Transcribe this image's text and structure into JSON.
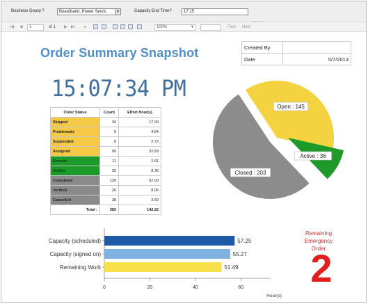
{
  "params": {
    "business_group_label": "Business Gourp ?",
    "business_group_value": "Boardband, Power Servic",
    "capacity_end_label": "Capacity End Time?",
    "capacity_end_value": "17:15"
  },
  "toolbar": {
    "page_current": "1",
    "page_of": "of 1",
    "zoom": "100%",
    "find_label": "Find",
    "next_label": "Next"
  },
  "report": {
    "title": "Order Summary Snapshot",
    "created_by_label": "Created By",
    "created_by_value": "",
    "date_label": "Date",
    "date_value": "5/7/2013",
    "clock": "15:07:34 PM",
    "emergency_label_1": "Remaining",
    "emergency_label_2": "Emergency Order",
    "emergency_value": "2"
  },
  "status_table": {
    "headers": [
      "Order Status",
      "Count",
      "Effort Hour(s)"
    ],
    "rows": [
      {
        "status": "Skipped",
        "count": "34",
        "hours": "17.00",
        "color": "#f5c945",
        "text_color": "#222222"
      },
      {
        "status": "Problematic",
        "count": "5",
        "hours": "4.94",
        "color": "#f5c945",
        "text_color": "#222222"
      },
      {
        "status": "Suspended",
        "count": "6",
        "hours": "2.72",
        "color": "#f5c945",
        "text_color": "#222222"
      },
      {
        "status": "Assigned",
        "count": "99",
        "hours": "32.83",
        "color": "#f5c945",
        "text_color": "#222222"
      },
      {
        "status": "Enroute",
        "count": "11",
        "hours": "2.61",
        "color": "#1d9b2a",
        "text_color": "#0b3d10"
      },
      {
        "status": "OnSite",
        "count": "25",
        "hours": "8.36",
        "color": "#1d9b2a",
        "text_color": "#0b3d10"
      },
      {
        "status": "Completed",
        "count": "139",
        "hours": "62.00",
        "color": "#8a8a8a",
        "text_color": "#222222"
      },
      {
        "status": "Verified",
        "count": "26",
        "hours": "8.06",
        "color": "#8a8a8a",
        "text_color": "#222222"
      },
      {
        "status": "Cancelled",
        "count": "38",
        "hours": "3.69",
        "color": "#8a8a8a",
        "text_color": "#222222"
      }
    ],
    "total_label": "Total :",
    "total_count": "383",
    "total_hours": "142.22"
  },
  "chart_data": [
    {
      "type": "pie",
      "slices": [
        {
          "label": "Open : 145",
          "value": 145,
          "color": "#f5d23f"
        },
        {
          "label": "Active : 36",
          "value": 36,
          "color": "#1e9a2b"
        },
        {
          "label": "Closed : 203",
          "value": 203,
          "color": "#8c8c8c"
        }
      ]
    },
    {
      "type": "bar",
      "orientation": "horizontal",
      "categories": [
        "Capacity (scheduled)",
        "Capacity (signed on)",
        "Remaining Work"
      ],
      "values": [
        57.25,
        55.27,
        51.49
      ],
      "data_labels": [
        "57.25",
        "55.27",
        "51.49"
      ],
      "colors": [
        "#1f5aa6",
        "#7fb2e0",
        "#f9e04a"
      ],
      "xlim": [
        0,
        70
      ],
      "xticks": [
        "0",
        "20",
        "40",
        "60"
      ],
      "xlabel": "Hour(s)"
    }
  ]
}
